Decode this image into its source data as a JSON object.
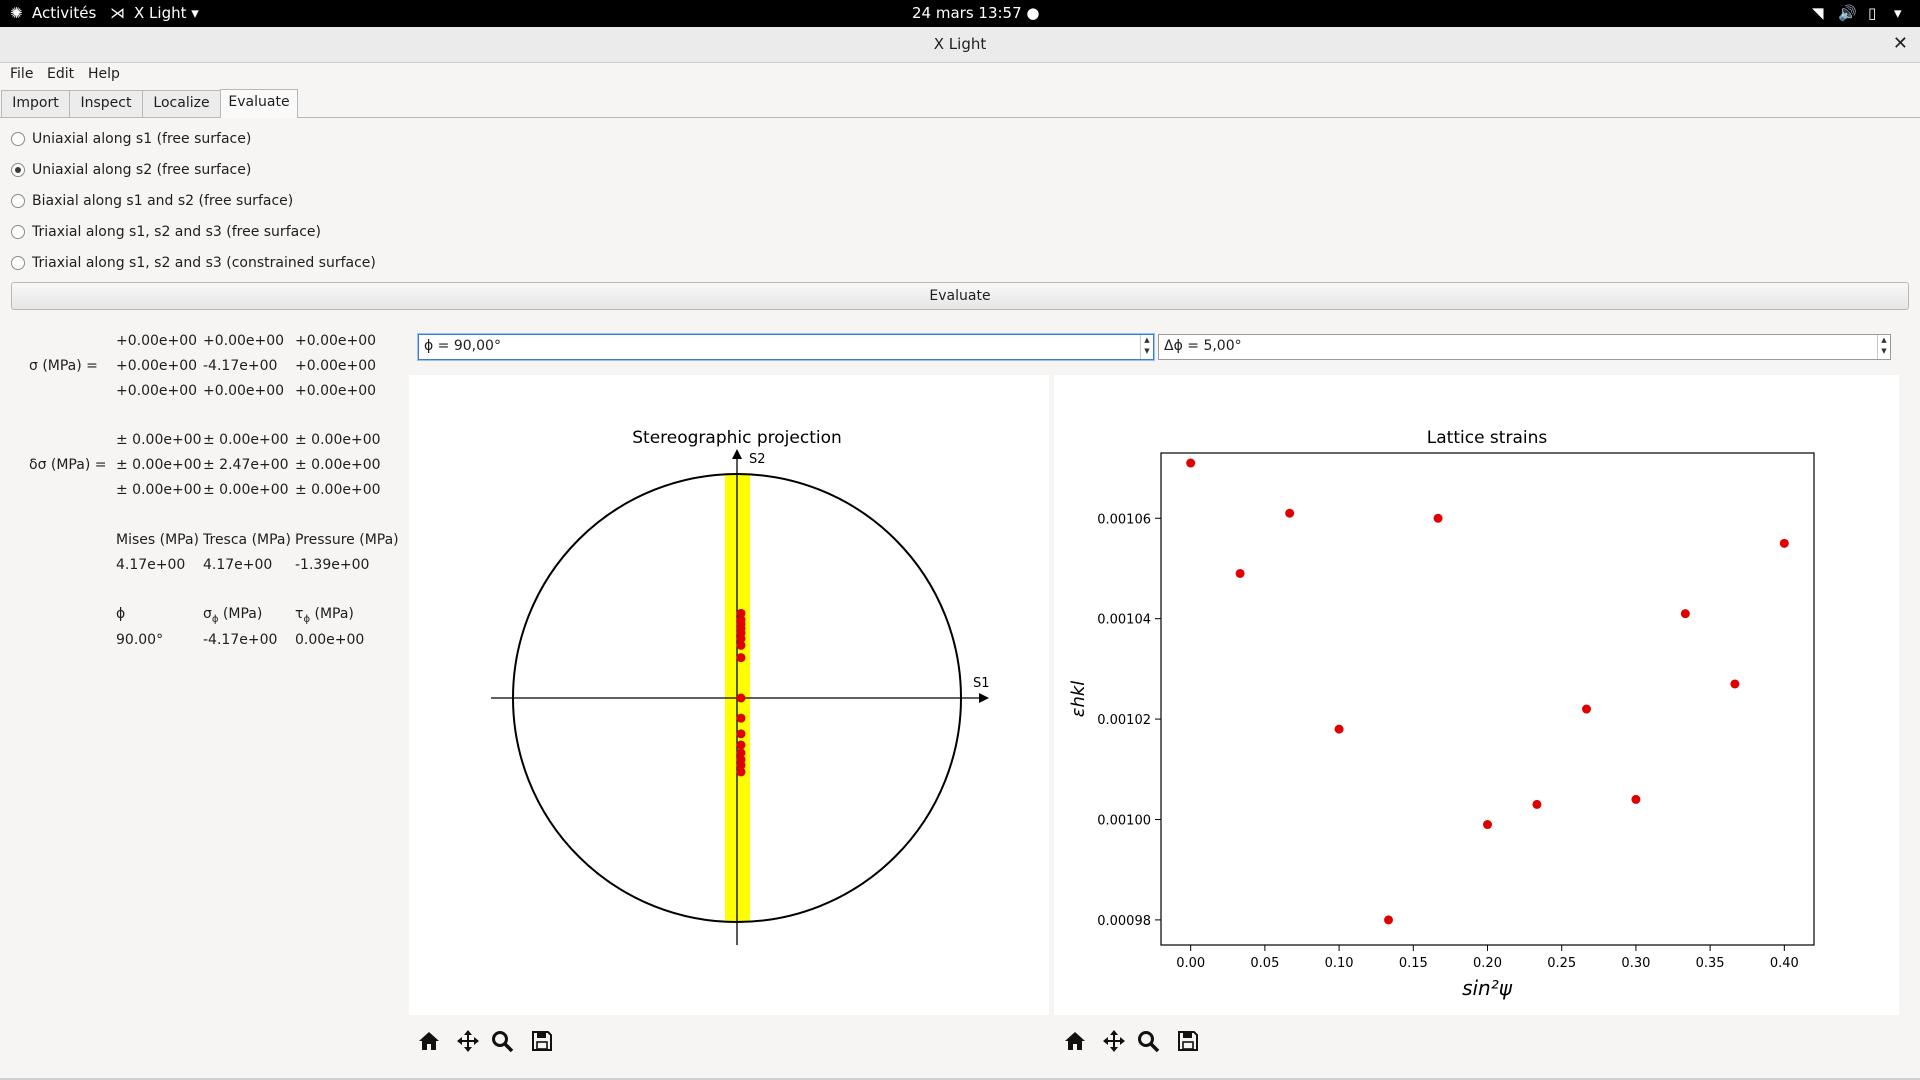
{
  "system_bar": {
    "activities": "Activités",
    "app_menu": "X Light",
    "datetime": "24 mars  13:57"
  },
  "window": {
    "title": "X Light"
  },
  "menu": {
    "file": "File",
    "edit": "Edit",
    "help": "Help"
  },
  "tabs": [
    {
      "label": "Import",
      "active": false
    },
    {
      "label": "Inspect",
      "active": false
    },
    {
      "label": "Localize",
      "active": false
    },
    {
      "label": "Evaluate",
      "active": true
    }
  ],
  "options": [
    {
      "label": "Uniaxial along s1 (free surface)",
      "checked": false
    },
    {
      "label": "Uniaxial along s2 (free surface)",
      "checked": true
    },
    {
      "label": "Biaxial along s1 and s2 (free surface)",
      "checked": false
    },
    {
      "label": "Triaxial along s1, s2 and s3 (free surface)",
      "checked": false
    },
    {
      "label": "Triaxial along s1, s2 and s3 (constrained surface)",
      "checked": false
    }
  ],
  "evaluate_button": "Evaluate",
  "stress": {
    "sigma_label": "σ (MPa) =",
    "sigma": [
      [
        "+0.00e+00",
        "+0.00e+00",
        "+0.00e+00"
      ],
      [
        "+0.00e+00",
        "-4.17e+00",
        "+0.00e+00"
      ],
      [
        "+0.00e+00",
        "+0.00e+00",
        "+0.00e+00"
      ]
    ],
    "dsigma_label": "δσ (MPa) =",
    "dsigma": [
      [
        "± 0.00e+00",
        "± 0.00e+00",
        "± 0.00e+00"
      ],
      [
        "± 0.00e+00",
        "± 2.47e+00",
        "± 0.00e+00"
      ],
      [
        "± 0.00e+00",
        "± 0.00e+00",
        "± 0.00e+00"
      ]
    ],
    "headers": [
      "Mises (MPa)",
      "Tresca (MPa)",
      "Pressure (MPa)"
    ],
    "values": [
      "4.17e+00",
      "4.17e+00",
      "-1.39e+00"
    ],
    "phi_header": "ϕ",
    "sigma_phi_header": "σ",
    "sigma_phi_sub": "ϕ",
    "sigma_phi_unit": " (MPa)",
    "tau_phi_header": "τ",
    "tau_phi_sub": "ϕ",
    "tau_phi_unit": " (MPa)",
    "phi_value": "90.00°",
    "sigma_phi_value": "-4.17e+00",
    "tau_phi_value": "0.00e+00"
  },
  "phi_spin": "ϕ = 90,00°",
  "dphi_spin": "Δϕ = 5,00°",
  "stereo": {
    "title": "Stereographic projection",
    "label_s1": "S1",
    "label_s2": "S2",
    "band_color": "#ffff00",
    "point_color": "#e00000",
    "points_y_fraction": [
      0.378,
      0.35,
      0.33,
      0.31,
      0.29,
      0.265,
      0.235,
      0.18,
      0.0,
      -0.09,
      -0.16,
      -0.21,
      -0.245,
      -0.275,
      -0.3,
      -0.33
    ]
  },
  "chart_data": {
    "type": "scatter",
    "title": "Lattice strains",
    "xlabel": "sin²ψ",
    "ylabel": "εhkl",
    "xlim": [
      -0.02,
      0.42
    ],
    "ylim": [
      0.000975,
      0.001073
    ],
    "xticks": [
      "0.00",
      "0.05",
      "0.10",
      "0.15",
      "0.20",
      "0.25",
      "0.30",
      "0.35",
      "0.40"
    ],
    "yticks": [
      "0.00098",
      "0.00100",
      "0.00102",
      "0.00104",
      "0.00106"
    ],
    "x": [
      0.0,
      0.0333,
      0.0667,
      0.1,
      0.1333,
      0.1667,
      0.2,
      0.2333,
      0.2667,
      0.3,
      0.3333,
      0.3667,
      0.4
    ],
    "y": [
      0.001071,
      0.001049,
      0.001061,
      0.001018,
      0.00098,
      0.00106,
      0.000999,
      0.001003,
      0.001022,
      0.001004,
      0.001041,
      0.001027,
      0.001055
    ],
    "color": "#e00000",
    "grid": false
  }
}
